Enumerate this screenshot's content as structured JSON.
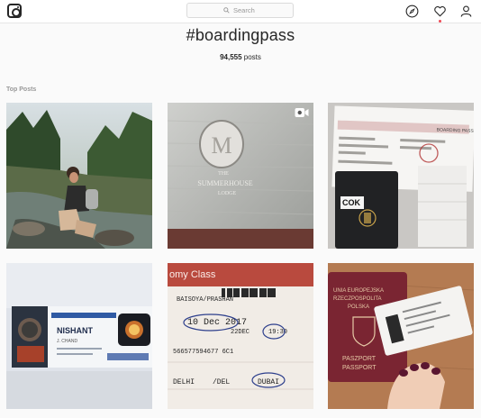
{
  "header": {
    "search_placeholder": "Search",
    "icons": [
      "instagram-logo",
      "search-icon",
      "compass-icon",
      "heart-icon",
      "person-icon"
    ]
  },
  "tag": {
    "title": "#boardingpass",
    "post_count": "94,555",
    "post_label": "posts"
  },
  "section": {
    "label": "Top Posts"
  },
  "posts": [
    {
      "name": "hiker by stream",
      "overlay": null
    },
    {
      "name": "hotel reflection",
      "overlay": [
        "THE",
        "SUMMERHOUSE",
        "LODGE",
        "video-icon"
      ]
    },
    {
      "name": "boarding pass with passport",
      "overlay": [
        "COK",
        "BOARDING PASS"
      ]
    },
    {
      "name": "space themed boarding pass",
      "overlay": [
        "NISHANT",
        "J. CHAND"
      ]
    },
    {
      "name": "air india economy boarding pass",
      "overlay": [
        "omy Class",
        "BAISOYA/PRASHAN",
        "10 Dec 2017",
        "22DEC",
        "19:30",
        "566577594677 6C1",
        "DELHI",
        "/DEL",
        "DUBAI"
      ]
    },
    {
      "name": "polish passport with ticket",
      "overlay": [
        "UNIA EUROPEJSKA",
        "RZECZPOSPOLITA",
        "POLSKA",
        "PASZPORT",
        "PASSPORT"
      ]
    }
  ]
}
